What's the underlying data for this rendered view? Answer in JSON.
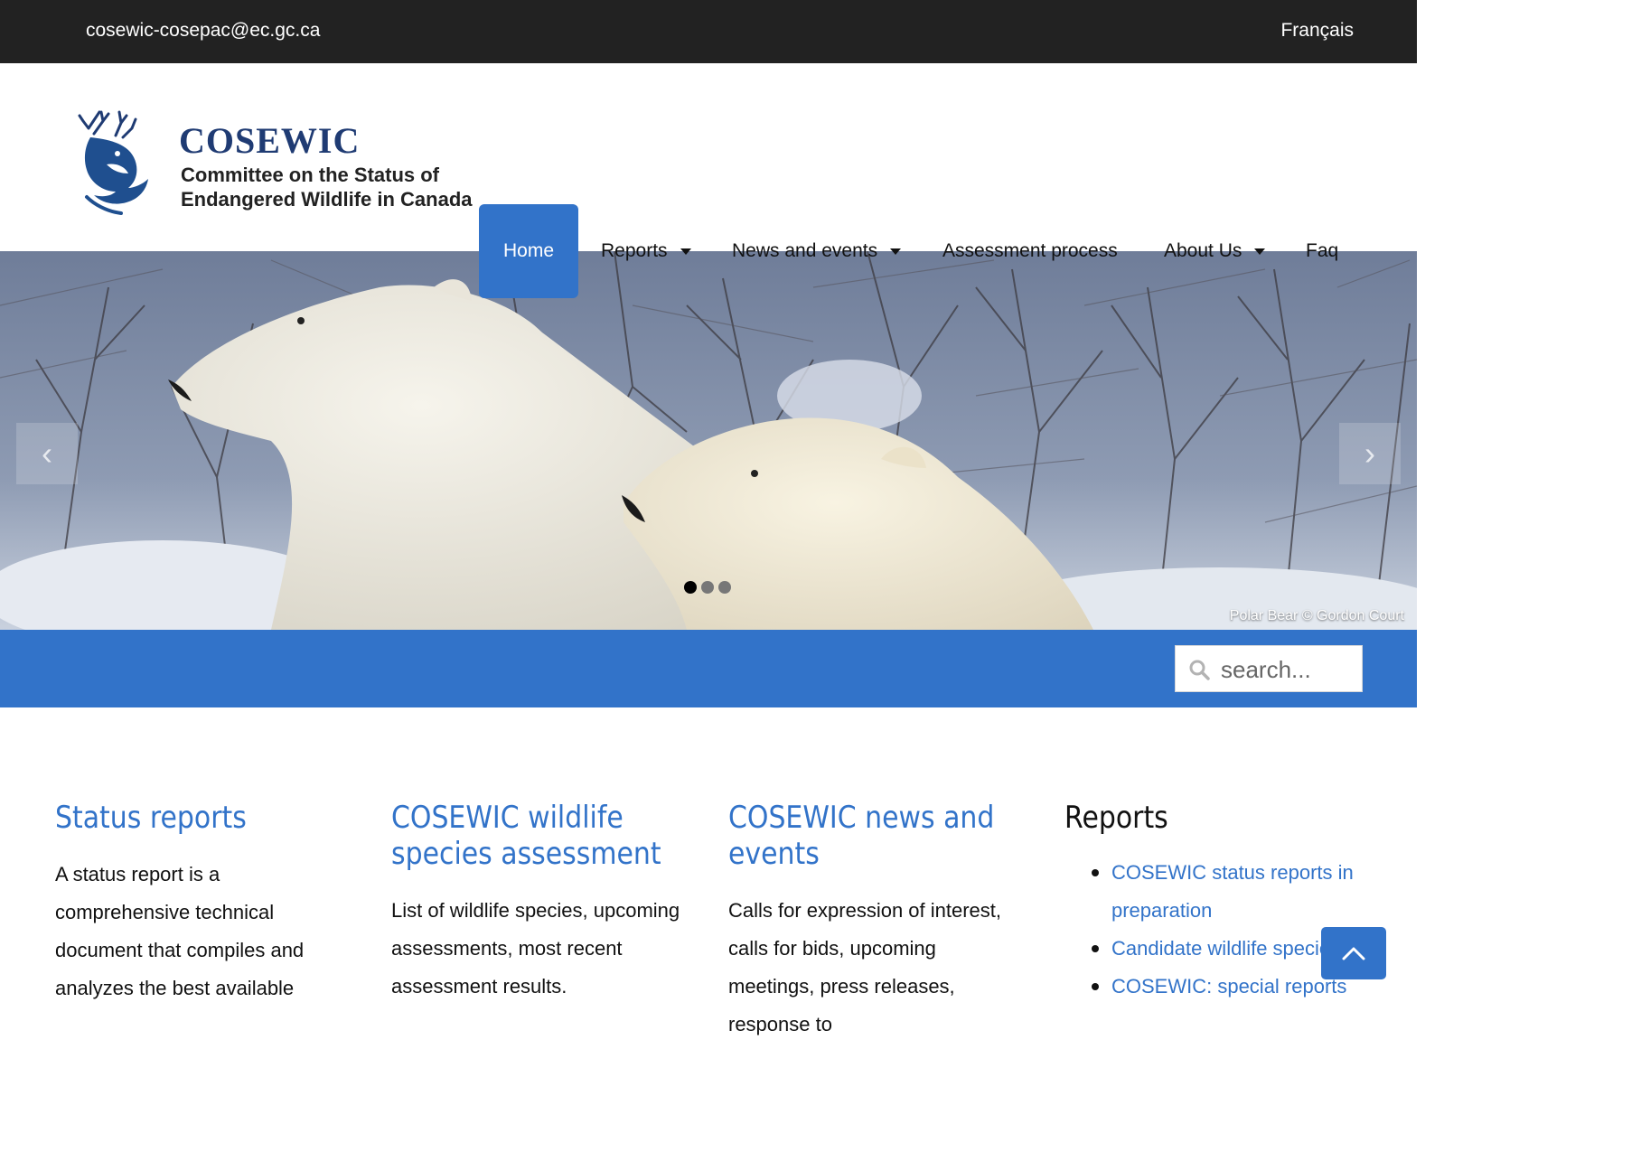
{
  "topbar": {
    "email": "cosewic-cosepac@ec.gc.ca",
    "language_link": "Français"
  },
  "logo": {
    "title": "COSEWIC",
    "subtitle_line1": "Committee on the Status of",
    "subtitle_line2": "Endangered Wildlife in Canada"
  },
  "nav": {
    "home": "Home",
    "reports": "Reports",
    "news": "News and events",
    "assessment": "Assessment process",
    "about": "About Us",
    "faq": "Faq"
  },
  "hero": {
    "prev": "‹",
    "next": "›",
    "credit": "Polar Bear © Gordon Court",
    "slides": 3,
    "active_slide": 1
  },
  "search": {
    "placeholder": "search..."
  },
  "columns": {
    "status": {
      "title": "Status reports",
      "text": "A status report is a comprehensive technical document that compiles and analyzes the best available"
    },
    "assessment": {
      "title": "COSEWIC wildlife species assessment",
      "text": "List of wildlife species, upcoming assessments, most recent assessment results."
    },
    "news": {
      "title": "COSEWIC news and events",
      "text": "Calls for expression of interest, calls for bids, upcoming meetings, press releases, response to"
    },
    "reports": {
      "title": "Reports",
      "links": [
        "COSEWIC status reports in preparation",
        "Candidate wildlife species",
        "COSEWIC: special reports"
      ]
    }
  },
  "colors": {
    "accent": "#3273c9",
    "topbar": "#222222",
    "logo_navy": "#1f3b73"
  }
}
